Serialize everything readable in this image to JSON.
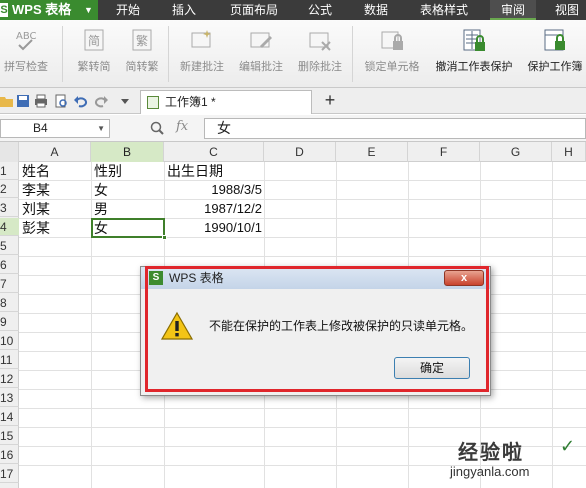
{
  "app": {
    "name": "WPS 表格",
    "logo_letter": "S"
  },
  "menu": {
    "tabs": [
      {
        "label": "开始"
      },
      {
        "label": "插入"
      },
      {
        "label": "页面布局"
      },
      {
        "label": "公式"
      },
      {
        "label": "数据"
      },
      {
        "label": "表格样式"
      },
      {
        "label": "审阅",
        "active": true
      },
      {
        "label": "视图"
      }
    ]
  },
  "ribbon": {
    "buttons": [
      {
        "label": "拼写检查",
        "icon": "abc-spellcheck-icon",
        "enabled": false
      },
      {
        "label": "繁转简",
        "icon": "traditional-to-simplified-icon",
        "enabled": false
      },
      {
        "label": "简转繁",
        "icon": "simplified-to-traditional-icon",
        "enabled": false
      },
      {
        "label": "新建批注",
        "icon": "new-comment-icon",
        "enabled": false
      },
      {
        "label": "编辑批注",
        "icon": "edit-comment-icon",
        "enabled": false
      },
      {
        "label": "删除批注",
        "icon": "delete-comment-icon",
        "enabled": false
      },
      {
        "label": "锁定单元格",
        "icon": "lock-cell-icon",
        "enabled": false
      },
      {
        "label": "撤消工作表保护",
        "icon": "unprotect-sheet-icon",
        "enabled": true
      },
      {
        "label": "保护工作簿",
        "icon": "protect-workbook-icon",
        "enabled": true
      }
    ]
  },
  "document": {
    "tab_label": "工作簿1 *"
  },
  "formula_bar": {
    "name_box": "B4",
    "fx": "fx",
    "value": "女"
  },
  "sheet": {
    "columns": [
      "A",
      "B",
      "C",
      "D",
      "E",
      "F",
      "G",
      "H"
    ],
    "selected_column": "B",
    "rows": [
      "1",
      "2",
      "3",
      "4",
      "5",
      "6",
      "7",
      "8",
      "9",
      "10",
      "11",
      "12",
      "13",
      "14",
      "15",
      "16",
      "17"
    ],
    "selected_row": "4",
    "cells": {
      "A1": "姓名",
      "B1": "性别",
      "C1": "出生日期",
      "A2": "李某",
      "B2": "女",
      "C2": "1988/3/5",
      "A3": "刘某",
      "B3": "男",
      "C3": "1987/12/2",
      "A4": "彭某",
      "B4": "女",
      "C4": "1990/10/1"
    }
  },
  "dialog": {
    "title": "WPS 表格",
    "message": "不能在保护的工作表上修改被保护的只读单元格。",
    "ok_label": "确定",
    "close_label": "x",
    "icon": "warning-icon"
  },
  "watermark": {
    "main": "经验啦",
    "check": "✓",
    "sub": "jingyanla.com"
  },
  "colors": {
    "accent": "#3a8b2f",
    "menu_bg": "#3b3b3b",
    "highlight": "#e0262c",
    "selection": "#d6e9c6"
  }
}
